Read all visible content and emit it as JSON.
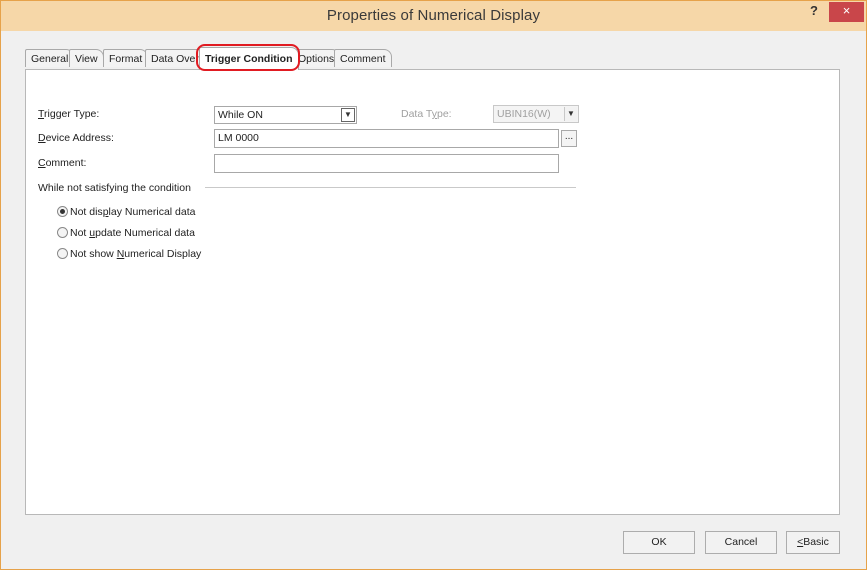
{
  "window": {
    "title": "Properties of Numerical Display",
    "help": "?",
    "close": "×"
  },
  "tabs": [
    {
      "label": "General"
    },
    {
      "label": "View"
    },
    {
      "label": "Format"
    },
    {
      "label": "Data Over"
    },
    {
      "label": "Trigger Condition",
      "active": true
    },
    {
      "label": "Options"
    },
    {
      "label": "Comment"
    }
  ],
  "form": {
    "trigger_type": {
      "label_pre": "",
      "label_ul": "T",
      "label_post": "rigger Type:",
      "value": "While ON"
    },
    "data_type": {
      "label_pre": "Data T",
      "label_ul": "y",
      "label_post": "pe:",
      "value": "UBIN16(W)"
    },
    "device_address": {
      "label_pre": "",
      "label_ul": "D",
      "label_post": "evice Address:",
      "value": "LM 0000",
      "browse": "..."
    },
    "comment": {
      "label_pre": "",
      "label_ul": "C",
      "label_post": "omment:",
      "value": ""
    }
  },
  "condition_group": {
    "heading": "While not satisfying the condition",
    "options": [
      {
        "pre": "Not dis",
        "ul": "p",
        "post": "lay Numerical data",
        "checked": true
      },
      {
        "pre": "Not ",
        "ul": "u",
        "post": "pdate Numerical data",
        "checked": false
      },
      {
        "pre": "Not show ",
        "ul": "N",
        "post": "umerical Display",
        "checked": false
      }
    ]
  },
  "footer": {
    "ok": "OK",
    "cancel": "Cancel",
    "basic_ul": "<",
    "basic_post": "Basic"
  },
  "colors": {
    "title_bar": "#f6d7a8",
    "window_border": "#e6a24a",
    "close_button": "#c9464a",
    "highlight": "#e11b22"
  }
}
